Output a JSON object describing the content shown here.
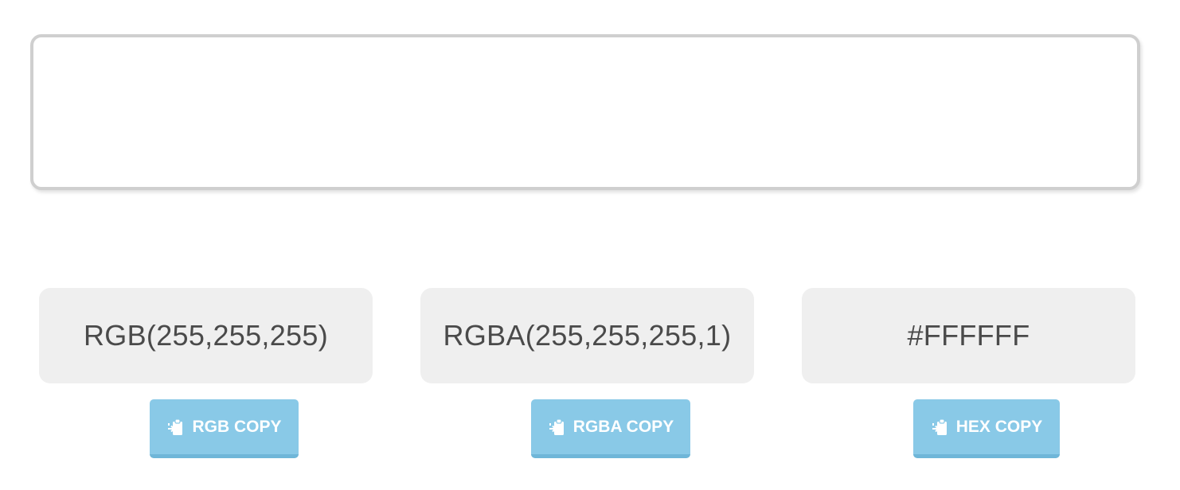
{
  "preview": {
    "color": "#FFFFFF"
  },
  "values": {
    "rgb": "RGB(255,255,255)",
    "rgba": "RGBA(255,255,255,1)",
    "hex": "#FFFFFF"
  },
  "buttons": {
    "rgb_copy": "RGB COPY",
    "rgba_copy": "RGBA COPY",
    "hex_copy": "HEX COPY",
    "icon": "clipboard-paste-icon"
  },
  "colors": {
    "button_bg": "#89c9e7",
    "button_border": "#6fb6d8",
    "value_bg": "#efefef",
    "text": "#4a4a4a"
  }
}
